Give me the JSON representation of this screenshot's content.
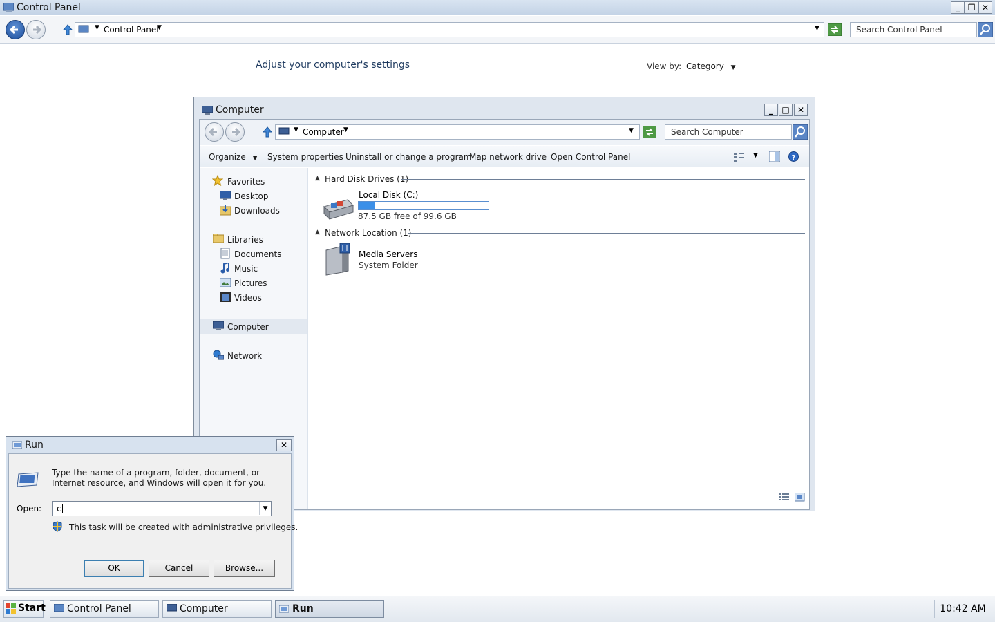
{
  "control_panel": {
    "title": "Control Panel",
    "breadcrumb": "Control Panel",
    "search_placeholder": "Search Control Panel",
    "heading": "Adjust your computer's settings",
    "view_by_label": "View by:",
    "view_by_value": "Category"
  },
  "computer_window": {
    "title": "Computer",
    "breadcrumb": "Computer",
    "search_placeholder": "Search Computer",
    "toolbar": {
      "organize": "Organize",
      "system_properties": "System properties",
      "uninstall": "Uninstall or change a program",
      "map_drive": "Map network drive",
      "open_cp": "Open Control Panel"
    },
    "nav": {
      "favorites": "Favorites",
      "desktop": "Desktop",
      "downloads": "Downloads",
      "libraries": "Libraries",
      "documents": "Documents",
      "music": "Music",
      "pictures": "Pictures",
      "videos": "Videos",
      "computer": "Computer",
      "network": "Network"
    },
    "groups": {
      "hdd_header": "Hard Disk Drives (1)",
      "net_header": "Network Location (1)"
    },
    "drive": {
      "name": "Local Disk (C:)",
      "free_text": "87.5 GB free of 99.6 GB",
      "used_fraction": 0.12
    },
    "network_item": {
      "name": "Media Servers",
      "type": "System Folder"
    }
  },
  "run_dialog": {
    "title": "Run",
    "description": "Type the name of a program, folder, document, or Internet resource, and Windows will open it for you.",
    "open_label": "Open:",
    "open_value": "c",
    "admin_note": "This task will be created with administrative privileges.",
    "ok": "OK",
    "cancel": "Cancel",
    "browse": "Browse..."
  },
  "taskbar": {
    "start": "Start",
    "items": [
      "Control Panel",
      "Computer",
      "Run"
    ],
    "clock": "10:42 AM"
  },
  "colors": {
    "accent": "#3c7fb1",
    "title_bar": "#c4d3e6",
    "drive_bar": "#3b8fe8"
  }
}
